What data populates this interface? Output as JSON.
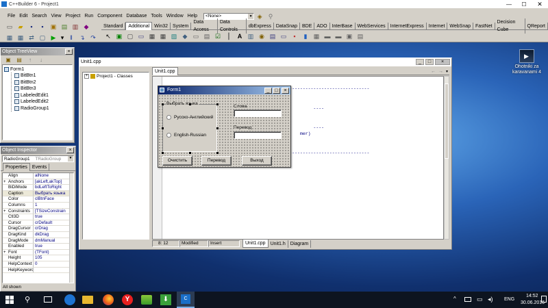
{
  "app": {
    "title": "C++Builder 6 - Project1"
  },
  "menu": [
    "File",
    "Edit",
    "Search",
    "View",
    "Project",
    "Run",
    "Component",
    "Database",
    "Tools",
    "Window",
    "Help"
  ],
  "config_combo": "<None>",
  "palette_tabs": [
    "Standard",
    "Additional",
    "Win32",
    "System",
    "Data Access",
    "Data Controls",
    "dbExpress",
    "DataSnap",
    "BDE",
    "ADO",
    "InterBase",
    "WebServices",
    "InternetExpress",
    "Internet",
    "WebSnap",
    "FastNet",
    "Decision Cube",
    "QReport"
  ],
  "treeview": {
    "title": "Object TreeView",
    "root": "Form1",
    "children": [
      "BitBtn1",
      "BitBtn2",
      "BitBtn3",
      "LabeledEdit1",
      "LabeledEdit2",
      "RadioGroup1"
    ]
  },
  "inspector": {
    "title": "Object Inspector",
    "object": "RadioGroup1",
    "object_type": "TRadioGroup",
    "tabs": [
      "Properties",
      "Events"
    ],
    "props": [
      {
        "n": "Align",
        "v": "alNone"
      },
      {
        "n": "Anchors",
        "v": "[akLeft,akTop]",
        "exp": "+"
      },
      {
        "n": "BiDiMode",
        "v": "bdLeftToRight"
      },
      {
        "n": "Caption",
        "v": "Выбрать языка"
      },
      {
        "n": "Color",
        "v": "clBtnFace"
      },
      {
        "n": "Columns",
        "v": "1"
      },
      {
        "n": "Constraints",
        "v": "[TSizeConstrain",
        "exp": "+"
      },
      {
        "n": "Ctl3D",
        "v": "true"
      },
      {
        "n": "Cursor",
        "v": "crDefault"
      },
      {
        "n": "DragCursor",
        "v": "crDrag"
      },
      {
        "n": "DragKind",
        "v": "dkDrag"
      },
      {
        "n": "DragMode",
        "v": "dmManual"
      },
      {
        "n": "Enabled",
        "v": "true"
      },
      {
        "n": "Font",
        "v": "(TFont)",
        "exp": "+"
      },
      {
        "n": "Height",
        "v": "105"
      },
      {
        "n": "HelpContext",
        "v": "0"
      },
      {
        "n": "HelpKeyword",
        "v": ""
      }
    ],
    "status": "All shown"
  },
  "editor": {
    "title": "Unit1.cpp",
    "class_tree": "Project1 - Classes",
    "tab": "Unit1.cpp",
    "code_fragment": "mer)",
    "status": {
      "pos": "8: 12",
      "modified": "Modified",
      "mode": "Insert"
    },
    "bottom_tabs": [
      "Unit1.cpp",
      "Unit1.h",
      "Diagram"
    ]
  },
  "form": {
    "title": "Form1",
    "group_caption": "Выбрать языка",
    "radios": [
      "Русско-Английский",
      "English-Russian"
    ],
    "label1": "Слова",
    "label2": "Перевод",
    "buttons": [
      "Очистить",
      "Перевод",
      "Выход"
    ]
  },
  "desktop": {
    "icon_label": "Ohotniki za karavanami 4"
  },
  "taskbar": {
    "lang": "ENG",
    "time": "14:52",
    "date": "30.06.2016"
  }
}
